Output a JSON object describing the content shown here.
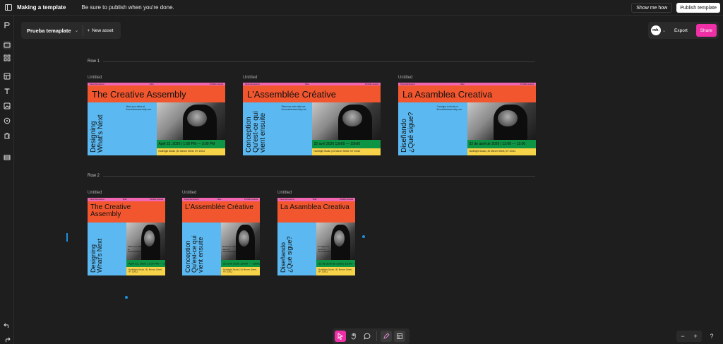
{
  "topbar": {
    "title": "Making a template",
    "message": "Be sure to publish when you're done.",
    "show_me_how": "Show me how",
    "publish": "Publish template"
  },
  "asset": {
    "name": "Prueba temaplate",
    "new_asset": "New asset"
  },
  "share": {
    "avatar": "mh.",
    "export": "Export",
    "share": "Share"
  },
  "rows": [
    {
      "label": "Row 1"
    },
    {
      "label": "Row 2"
    }
  ],
  "cards": [
    {
      "label": "Untitled",
      "title": "The Creative Assembly",
      "vertical": "Designing What's Next",
      "date": "April 22, 2026 | 1:00 PM — 3:00 PM",
      "address": "Northlight Studio | 81 Mercer Street, NY 10012",
      "blurb": "Mark your dates at thecreativeassembly.com",
      "top": [
        "Panel discussions",
        "Talks",
        "Portfolio reviews"
      ]
    },
    {
      "label": "Untitled",
      "title": "L'Assemblée Créative",
      "vertical": "Conception Qu'est-ce qui vient ensuite",
      "date": "22 avril 2026 13h00 — 15h00",
      "address": "Northlight Studio | 81 Mercer Street, NY 10012",
      "blurb": "Réservez votre date sur thecreativeassembly.com",
      "top": [
        "Panel discussions",
        "Talks",
        "Portfolio reviews"
      ]
    },
    {
      "label": "Untitled",
      "title": "La Asamblea Creativa",
      "vertical": "Diseñando ¿Qué sigue?",
      "date": "22 de abril de 2026 | 13:00 — 15:00",
      "address": "Northlight Studio | 81 Mercer Street, NY 10012",
      "blurb": "Consigue tu fecha en thecreativeassembly.com",
      "top": [
        "Panel discussions",
        "Talks",
        "Portfolio reviews"
      ]
    },
    {
      "label": "Untitled",
      "title": "The Creative Assembly",
      "vertical": "Designing What's Next",
      "date": "April 22, 2026 | 1:00 PM — 3:00 PM",
      "address": "Northlight Studio | 81 Mercer Street, NY 10012",
      "blurb": "Mark your dates at thecreativeassembly.com",
      "top": [
        "Panel discussions",
        "Talks",
        "Portfolio reviews"
      ]
    },
    {
      "label": "Untitled",
      "title": "L'Assemblée Créative",
      "vertical": "Conception Qu'est-ce qui vient ensuite",
      "date": "22 avril 2026 13h00 — 15h00",
      "address": "Northlight Studio | 81 Mercer Street, NY 10012",
      "blurb": "Réservez votre date sur thecreativeassembly.com",
      "top": [
        "Panel discussions",
        "Talks",
        "Portfolio reviews"
      ]
    },
    {
      "label": "Untitled",
      "title": "La Asamblea Creativa",
      "vertical": "Diseñando ¿Qué sigue?",
      "date": "22 de abril de 2026 | 13:00 — 15:00",
      "address": "Northlight Studio | 81 Mercer Street, NY 10012",
      "blurb": "Consigue tu fecha en thecreativeassembly.com",
      "top": [
        "Panel discussions",
        "Talks",
        "Portfolio reviews"
      ]
    }
  ],
  "zoom": {
    "minus": "−",
    "plus": "+"
  },
  "help": "?",
  "colors": {
    "accent": "#ee2fa5",
    "selection": "#1d8fe0",
    "poster_blue": "#5bb8f0",
    "poster_orange": "#f2562e",
    "poster_pink": "#f066b3",
    "poster_green": "#0d9444",
    "poster_yellow": "#f7d34a"
  }
}
